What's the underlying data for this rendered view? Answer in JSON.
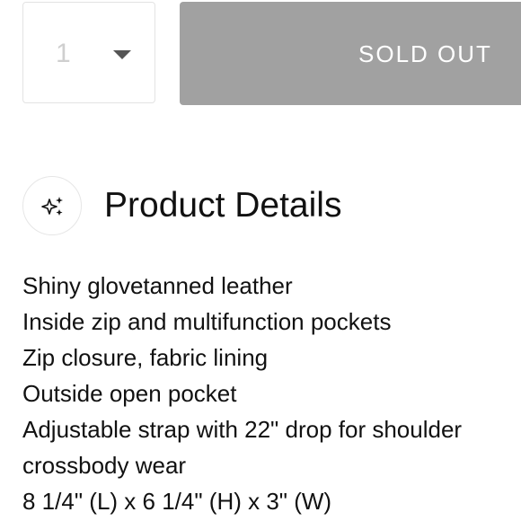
{
  "purchase": {
    "quantity_value": "1",
    "sold_out_label": "SOLD OUT"
  },
  "details": {
    "icon": "sparkle-icon",
    "title": "Product Details",
    "lines": [
      "Shiny glovetanned leather",
      "Inside zip and multifunction pockets",
      "Zip closure, fabric lining",
      "Outside open pocket",
      "Adjustable strap with 22\" drop for shoulder",
      "crossbody wear",
      "8 1/4\" (L) x 6 1/4\" (H) x 3\" (W)"
    ]
  },
  "colors": {
    "button_bg": "#a1a1a1",
    "button_text": "#ffffff",
    "text": "#111111",
    "border": "#e3e3e3"
  }
}
